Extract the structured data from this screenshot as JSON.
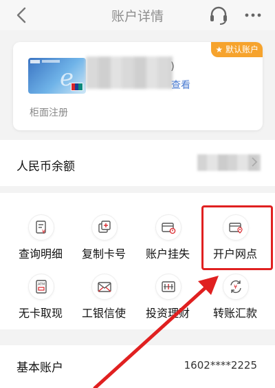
{
  "header": {
    "title": "账户详情",
    "back_icon": "chevron-left-icon",
    "service_icon": "headset-icon",
    "more_icon": "more-horizontal-icon"
  },
  "card": {
    "badge_label": "★ 默认账户",
    "paren": ")",
    "view_link": "查看",
    "register_note": "柜面注册"
  },
  "balance": {
    "label": "人民币余额"
  },
  "services": [
    {
      "label": "查询明细",
      "icon": "transaction-detail-icon"
    },
    {
      "label": "复制卡号",
      "icon": "copy-card-number-icon"
    },
    {
      "label": "账户挂失",
      "icon": "report-loss-icon"
    },
    {
      "label": "开户网点",
      "icon": "branch-location-icon"
    },
    {
      "label": "无卡取现",
      "icon": "atm-icon"
    },
    {
      "label": "工银信使",
      "icon": "envelope-icon"
    },
    {
      "label": "投资理财",
      "icon": "investment-icon"
    },
    {
      "label": "转账汇款",
      "icon": "transfer-icon"
    }
  ],
  "account": {
    "label": "基本账户",
    "number": "1602****2225"
  },
  "colors": {
    "accent_red": "#e02020",
    "badge_orange": "#f6a32d",
    "link_blue": "#4a7bd1"
  }
}
